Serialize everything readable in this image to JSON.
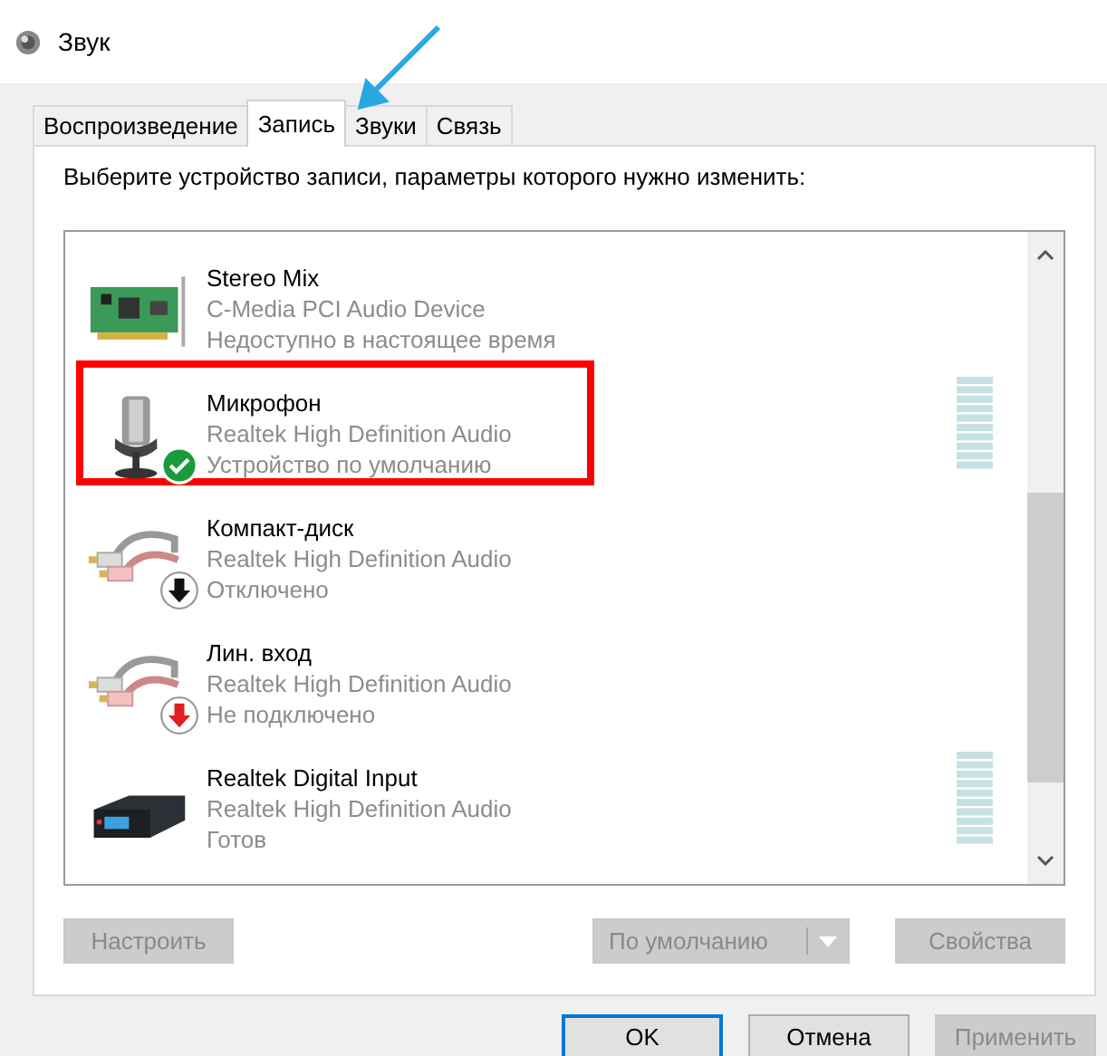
{
  "window": {
    "title": "Звук"
  },
  "tabs": [
    {
      "label": "Воспроизведение",
      "selected": false
    },
    {
      "label": "Запись",
      "selected": true
    },
    {
      "label": "Звуки",
      "selected": false
    },
    {
      "label": "Связь",
      "selected": false
    }
  ],
  "instruction": "Выберите устройство записи, параметры которого нужно изменить:",
  "devices": [
    {
      "name": "Stereo Mix",
      "driver": "C-Media PCI Audio Device",
      "status": "Недоступно в настоящее время",
      "kind": "card",
      "default": false,
      "disabled": false,
      "unplugged": false,
      "meter": false,
      "highlighted": false
    },
    {
      "name": "Микрофон",
      "driver": "Realtek High Definition Audio",
      "status": "Устройство по умолчанию",
      "kind": "microphone",
      "default": true,
      "disabled": false,
      "unplugged": false,
      "meter": true,
      "highlighted": true
    },
    {
      "name": "Компакт-диск",
      "driver": "Realtek High Definition Audio",
      "status": "Отключено",
      "kind": "line",
      "default": false,
      "disabled": true,
      "unplugged": false,
      "meter": false,
      "highlighted": false
    },
    {
      "name": "Лин. вход",
      "driver": "Realtek High Definition Audio",
      "status": "Не подключено",
      "kind": "line",
      "default": false,
      "disabled": false,
      "unplugged": true,
      "meter": false,
      "highlighted": false
    },
    {
      "name": "Realtek Digital Input",
      "driver": "Realtek High Definition Audio",
      "status": "Готов",
      "kind": "digital",
      "default": false,
      "disabled": false,
      "unplugged": false,
      "meter": true,
      "highlighted": false
    }
  ],
  "panel_buttons": [
    {
      "label": "Настроить",
      "kind": "plain",
      "disabled": true
    },
    {
      "label": "По умолчанию",
      "kind": "split",
      "disabled": true
    },
    {
      "label": "Свойства",
      "kind": "plain",
      "disabled": true
    }
  ],
  "dialog_buttons": [
    {
      "label": "OK",
      "default": true,
      "disabled": false
    },
    {
      "label": "Отмена",
      "default": false,
      "disabled": false
    },
    {
      "label": "Применить",
      "default": false,
      "disabled": true
    }
  ]
}
